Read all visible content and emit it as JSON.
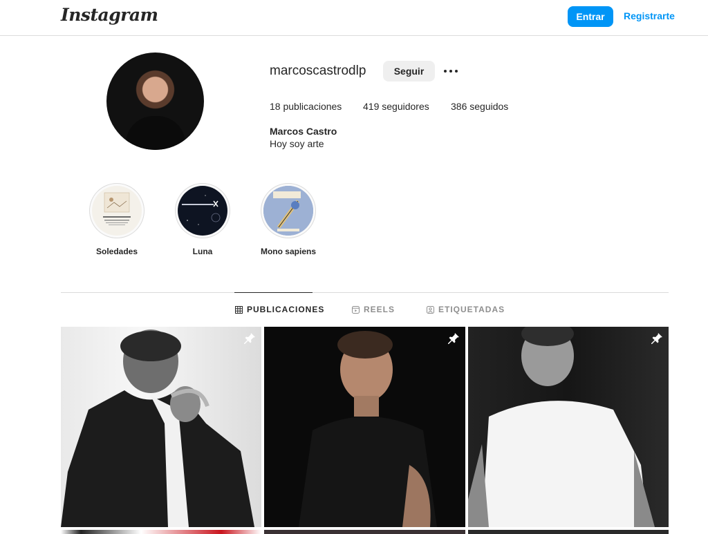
{
  "nav": {
    "logo": "Instagram",
    "login_label": "Entrar",
    "signup_label": "Registrarte"
  },
  "profile": {
    "username": "marcoscastrodlp",
    "follow_label": "Seguir",
    "stats": {
      "posts": "18 publicaciones",
      "followers": "419 seguidores",
      "following": "386 seguidos"
    },
    "full_name": "Marcos Castro",
    "bio": "Hoy soy arte"
  },
  "highlights": [
    {
      "label": "Soledades"
    },
    {
      "label": "Luna"
    },
    {
      "label": "Mono sapiens"
    }
  ],
  "tabs": [
    {
      "label": "PUBLICACIONES",
      "icon": "grid-icon",
      "active": true
    },
    {
      "label": "REELS",
      "icon": "reels-icon",
      "active": false
    },
    {
      "label": "ETIQUETADAS",
      "icon": "tagged-icon",
      "active": false
    }
  ],
  "posts": [
    {
      "pinned": true,
      "icon": "pin-icon"
    },
    {
      "pinned": true,
      "icon": "pin-icon"
    },
    {
      "pinned": true,
      "icon": "pin-icon"
    }
  ],
  "colors": {
    "accent": "#0095f6",
    "border": "#dbdbdb",
    "text": "#262626",
    "muted": "#8e8e8e"
  }
}
